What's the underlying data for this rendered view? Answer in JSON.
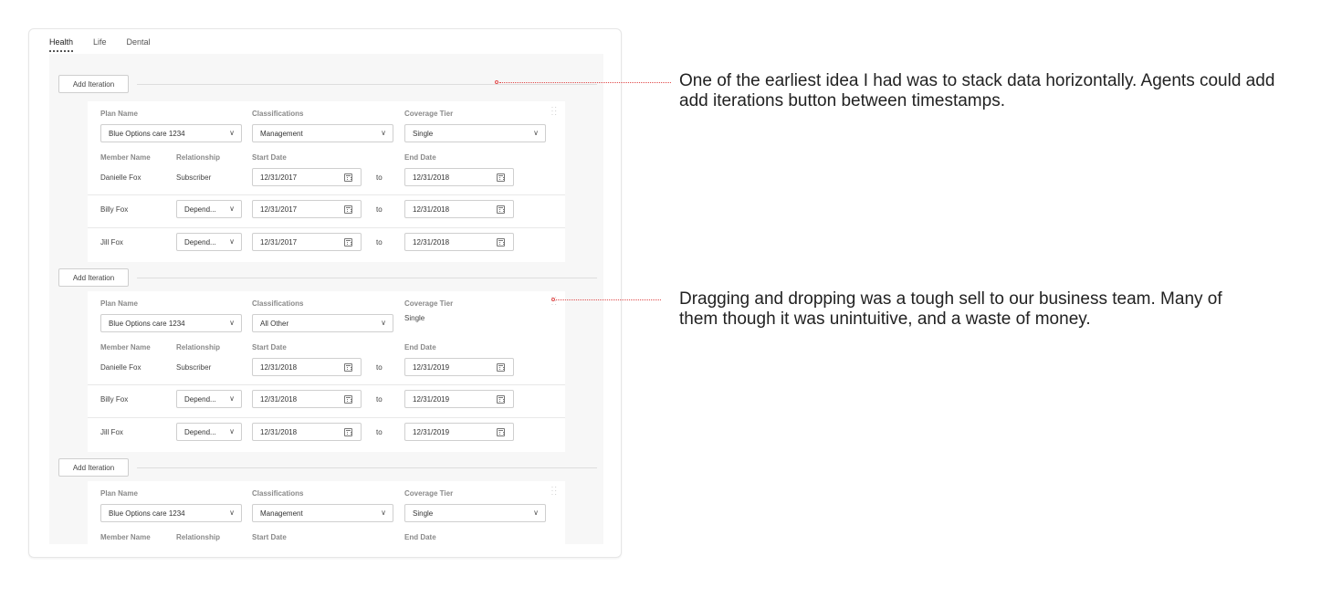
{
  "tabs": [
    "Health",
    "Life",
    "Dental"
  ],
  "add_iteration_label": "Add Iteration",
  "labels": {
    "plan_name": "Plan Name",
    "classifications": "Classifications",
    "coverage_tier": "Coverage Tier",
    "member_name": "Member Name",
    "relationship": "Relationship",
    "start_date": "Start Date",
    "end_date": "End Date",
    "to": "to"
  },
  "iterations": [
    {
      "plan": "Blue Options care 1234",
      "classification": "Management",
      "coverage_tier": "Single",
      "members": [
        {
          "name": "Danielle Fox",
          "relationship": "Subscriber",
          "start": "12/31/2017",
          "end": "12/31/2018"
        },
        {
          "name": "Billy Fox",
          "relationship": "Depend...",
          "start": "12/31/2017",
          "end": "12/31/2018"
        },
        {
          "name": "Jill Fox",
          "relationship": "Depend...",
          "start": "12/31/2017",
          "end": "12/31/2018"
        }
      ]
    },
    {
      "plan": "Blue Options care 1234",
      "classification": "All Other",
      "coverage_tier": "Single",
      "members": [
        {
          "name": "Danielle Fox",
          "relationship": "Subscriber",
          "start": "12/31/2018",
          "end": "12/31/2019"
        },
        {
          "name": "Billy Fox",
          "relationship": "Depend...",
          "start": "12/31/2018",
          "end": "12/31/2019"
        },
        {
          "name": "Jill Fox",
          "relationship": "Depend...",
          "start": "12/31/2018",
          "end": "12/31/2019"
        }
      ]
    },
    {
      "plan": "Blue Options care 1234",
      "classification": "Management",
      "coverage_tier": "Single"
    }
  ],
  "annotations": [
    "One of the earliest idea I had was to stack data horizontally. Agents could add add iterations button between timestamps.",
    "Dragging and dropping was a tough sell to our business team. Many of them though it was unintuitive, and a waste of money."
  ],
  "colors": {
    "annotation_line": "#e04a4a",
    "border": "#cfcfcf",
    "panel_bg": "#f7f7f7"
  },
  "icons": [
    "chevron-down-icon",
    "calendar-icon",
    "drag-handle-icon"
  ]
}
